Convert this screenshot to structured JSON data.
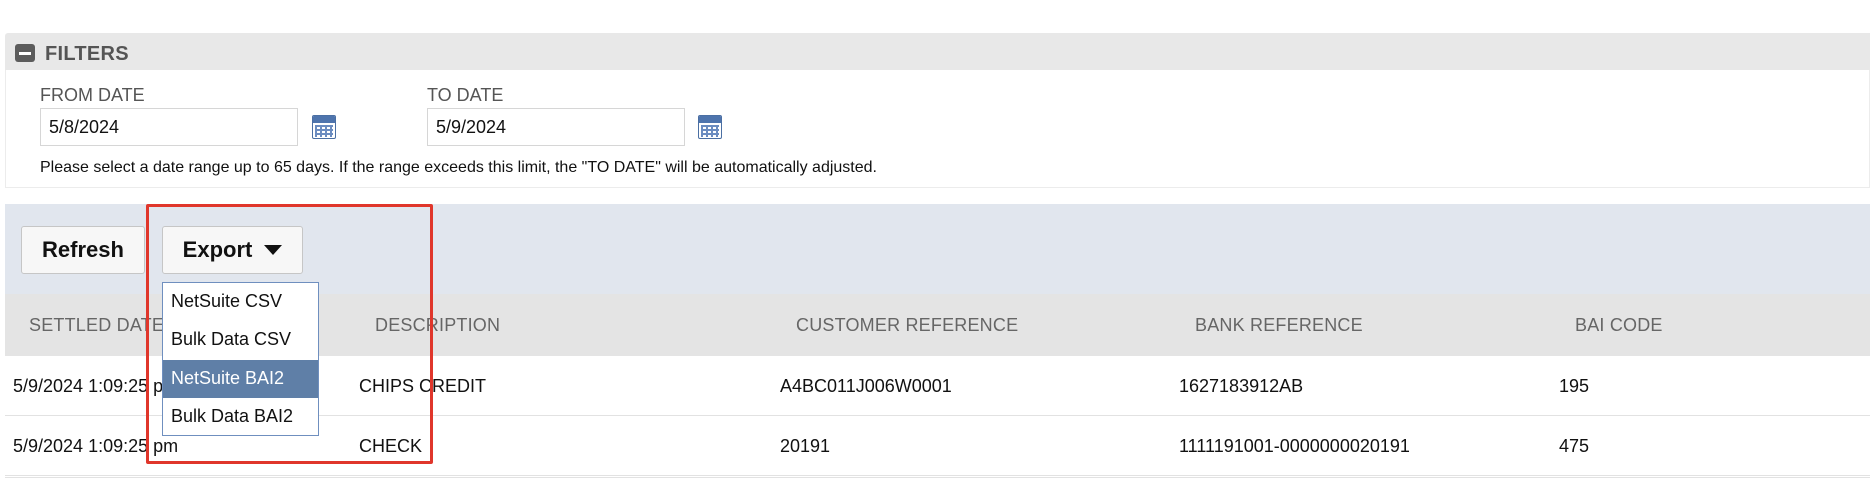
{
  "filters": {
    "title": "FILTERS",
    "from_label": "FROM DATE",
    "from_value": "5/8/2024",
    "to_label": "TO DATE",
    "to_value": "5/9/2024",
    "note": "Please select a date range up to 65 days. If the range exceeds this limit, the \"TO DATE\" will be automatically adjusted."
  },
  "toolbar": {
    "refresh_label": "Refresh",
    "export_label": "Export"
  },
  "export_menu": {
    "items": [
      "NetSuite CSV",
      "Bulk Data CSV",
      "NetSuite BAI2",
      "Bulk Data BAI2"
    ],
    "highlighted": "NetSuite BAI2"
  },
  "table": {
    "columns": [
      "SETTLED DATE",
      "DESCRIPTION",
      "CUSTOMER REFERENCE",
      "BANK REFERENCE",
      "BAI CODE"
    ],
    "rows": [
      [
        "5/9/2024 1:09:25 pm",
        "CHIPS CREDIT",
        "A4BC011J006W0001",
        "1627183912AB",
        "195"
      ],
      [
        "5/9/2024 1:09:25 pm",
        "CHECK",
        "20191",
        "1111191001-0000000020191",
        "475"
      ]
    ]
  },
  "colors": {
    "toolbar_bg": "#e1e6ee",
    "menu_highlight": "#5f7fa7",
    "annotation": "#e0362b"
  },
  "icons": {
    "collapse": "minus-square-icon",
    "calendar": "calendar-icon",
    "export_caret": "caret-down-icon"
  }
}
